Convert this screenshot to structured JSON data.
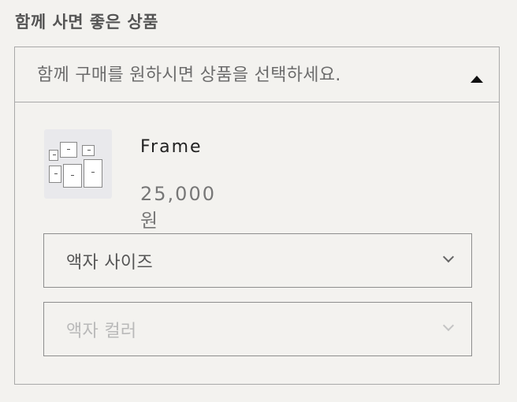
{
  "section": {
    "title": "함께 사면 좋은 상품"
  },
  "panel": {
    "header_text": "함께 구매를 원하시면 상품을 선택하세요.",
    "toggle_icon": "triangle-up-icon"
  },
  "product": {
    "name": "Frame",
    "price": "25,000원",
    "thumbnail_icon": "picture-frames-image"
  },
  "options": {
    "size": {
      "label": "액자 사이즈",
      "icon": "chevron-down-icon",
      "enabled": true
    },
    "color": {
      "label": "액자 컬러",
      "icon": "chevron-down-icon",
      "enabled": false
    }
  },
  "colors": {
    "background": "#f3f2ef",
    "border": "#a9a9a9",
    "disabled_text": "#b9b9b9"
  }
}
